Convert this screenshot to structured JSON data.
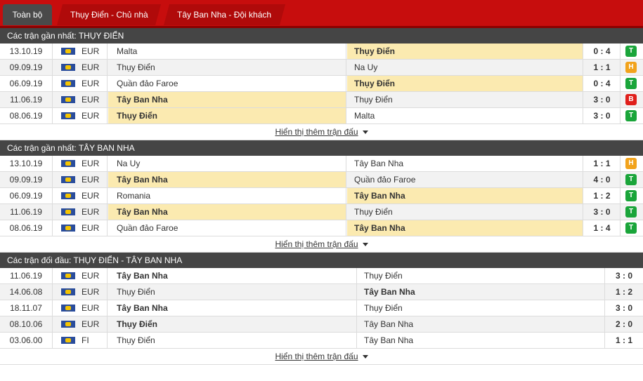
{
  "tabs": [
    "Toàn bộ",
    "Thụy Điển - Chủ nhà",
    "Tây Ban Nha - Đội khách"
  ],
  "sections": [
    {
      "title": "Các trận gần nhất: THỤY ĐIỂN",
      "more": "Hiển thị thêm trận đấu",
      "rows": [
        {
          "date": "13.10.19",
          "league": "EUR",
          "home": "Malta",
          "away": "Thụy Điển",
          "score": "0 : 4",
          "result": "T",
          "bold": "away"
        },
        {
          "date": "09.09.19",
          "league": "EUR",
          "home": "Thụy Điển",
          "away": "Na Uy",
          "score": "1 : 1",
          "result": "H",
          "bold": "none"
        },
        {
          "date": "06.09.19",
          "league": "EUR",
          "home": "Quần đảo Faroe",
          "away": "Thụy Điển",
          "score": "0 : 4",
          "result": "T",
          "bold": "away"
        },
        {
          "date": "11.06.19",
          "league": "EUR",
          "home": "Tây Ban Nha",
          "away": "Thụy Điển",
          "score": "3 : 0",
          "result": "B",
          "bold": "home"
        },
        {
          "date": "08.06.19",
          "league": "EUR",
          "home": "Thụy Điển",
          "away": "Malta",
          "score": "3 : 0",
          "result": "T",
          "bold": "home"
        }
      ]
    },
    {
      "title": "Các trận gần nhất: TÂY BAN NHA",
      "more": "Hiển thị thêm trận đấu",
      "rows": [
        {
          "date": "13.10.19",
          "league": "EUR",
          "home": "Na Uy",
          "away": "Tây Ban Nha",
          "score": "1 : 1",
          "result": "H",
          "bold": "none"
        },
        {
          "date": "09.09.19",
          "league": "EUR",
          "home": "Tây Ban Nha",
          "away": "Quần đảo Faroe",
          "score": "4 : 0",
          "result": "T",
          "bold": "home"
        },
        {
          "date": "06.09.19",
          "league": "EUR",
          "home": "Romania",
          "away": "Tây Ban Nha",
          "score": "1 : 2",
          "result": "T",
          "bold": "away"
        },
        {
          "date": "11.06.19",
          "league": "EUR",
          "home": "Tây Ban Nha",
          "away": "Thụy Điển",
          "score": "3 : 0",
          "result": "T",
          "bold": "home"
        },
        {
          "date": "08.06.19",
          "league": "EUR",
          "home": "Quần đảo Faroe",
          "away": "Tây Ban Nha",
          "score": "1 : 4",
          "result": "T",
          "bold": "away"
        }
      ]
    },
    {
      "title": "Các trận đối đầu: THỤY ĐIỂN - TÂY BAN NHA",
      "more": "Hiển thị thêm trận đấu",
      "rows": [
        {
          "date": "11.06.19",
          "league": "EUR",
          "home": "Tây Ban Nha",
          "away": "Thụy Điển",
          "score": "3 : 0",
          "bold": "home"
        },
        {
          "date": "14.06.08",
          "league": "EUR",
          "home": "Thụy Điển",
          "away": "Tây Ban Nha",
          "score": "1 : 2",
          "bold": "away"
        },
        {
          "date": "18.11.07",
          "league": "EUR",
          "home": "Tây Ban Nha",
          "away": "Thụy Điển",
          "score": "3 : 0",
          "bold": "home"
        },
        {
          "date": "08.10.06",
          "league": "EUR",
          "home": "Thụy Điển",
          "away": "Tây Ban Nha",
          "score": "2 : 0",
          "bold": "home"
        },
        {
          "date": "03.06.00",
          "league": "FI",
          "home": "Thụy Điển",
          "away": "Tây Ban Nha",
          "score": "1 : 1",
          "bold": "none"
        }
      ]
    }
  ]
}
